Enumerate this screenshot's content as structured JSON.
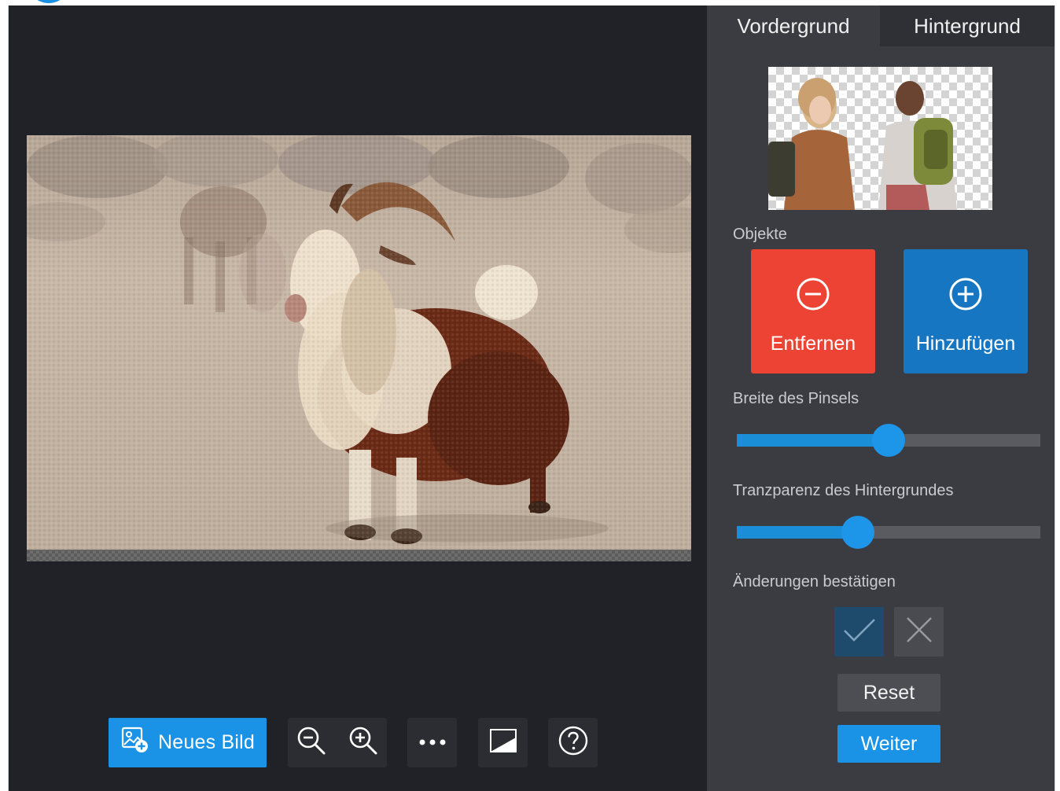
{
  "tabs": {
    "foreground": "Vordergrund",
    "background": "Hintergrund"
  },
  "panel": {
    "objects_label": "Objekte",
    "remove_label": "Entfernen",
    "add_label": "Hinzufügen",
    "brush_width_label": "Breite des Pinsels",
    "brush_width_value": 0.5,
    "bg_transparency_label": "Tranzparenz des Hintergrundes",
    "bg_transparency_value": 0.4,
    "confirm_label": "Änderungen bestätigen",
    "reset_label": "Reset",
    "next_label": "Weiter"
  },
  "toolbar": {
    "new_image_label": "Neues Bild"
  },
  "icons": {
    "new_image": "image-add-icon",
    "zoom_out": "zoom-out-icon",
    "zoom_in": "zoom-in-icon",
    "more": "more-icon",
    "compare": "compare-icon",
    "help": "help-icon",
    "remove": "minus-circle-icon",
    "add": "plus-circle-icon",
    "check": "check-icon",
    "cancel": "close-icon"
  },
  "colors": {
    "accent": "#1a93e6",
    "remove": "#ec4334",
    "add": "#1676c2",
    "panel": "#3b3c42",
    "canvas": "#212227"
  }
}
